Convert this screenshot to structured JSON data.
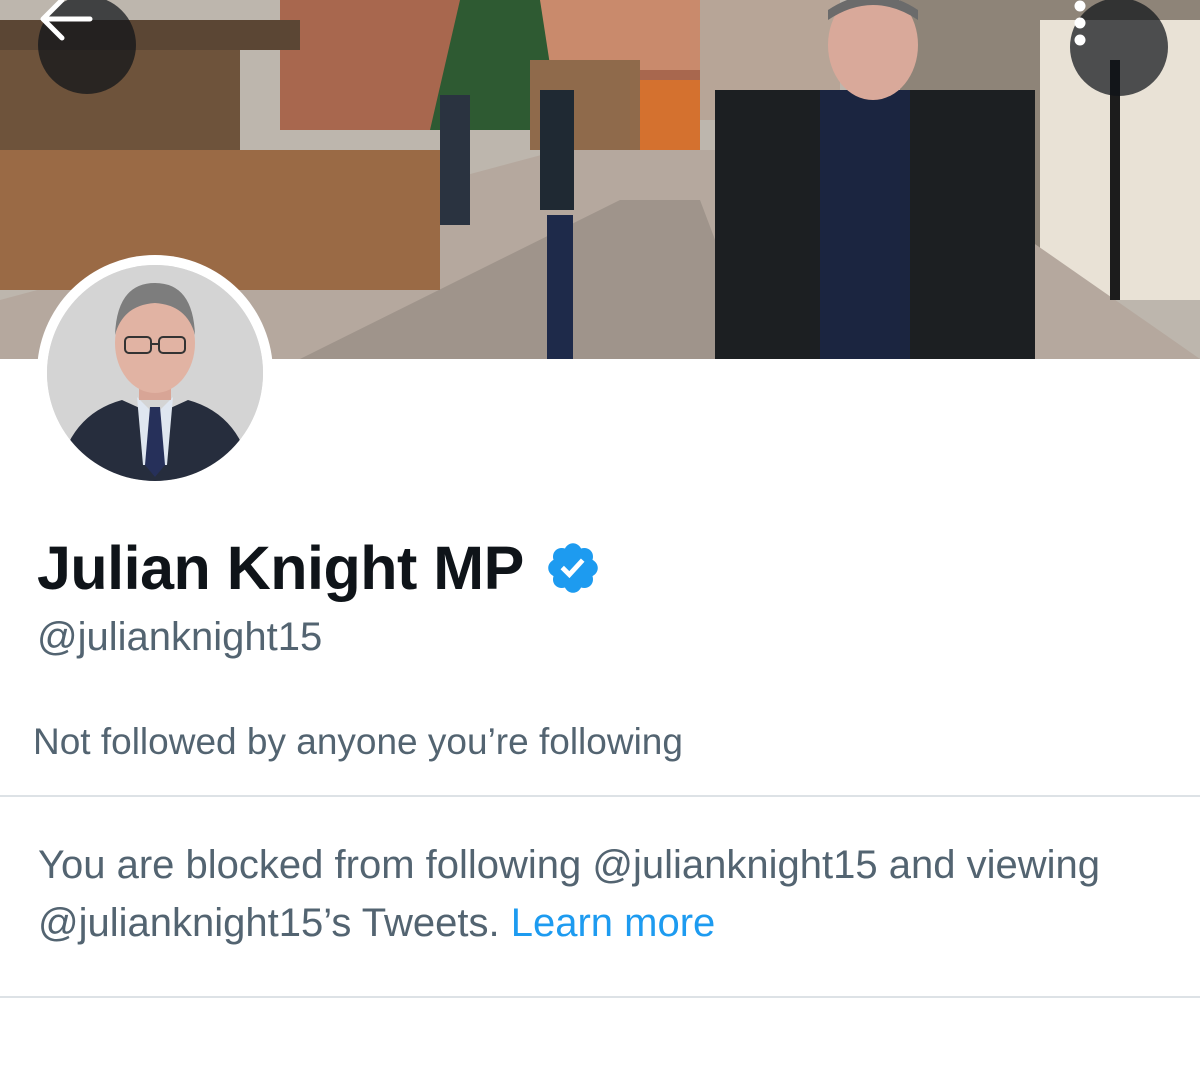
{
  "header": {
    "back_icon": "arrow-left-icon",
    "more_icon": "more-vertical-icon"
  },
  "profile": {
    "display_name": "Julian Knight MP",
    "verified": true,
    "verified_icon": "verified-badge-icon",
    "handle": "@julianknight15",
    "followers_you_know": "Not followed by anyone you’re following"
  },
  "blocked_notice": {
    "text": "You are blocked from following @julianknight15 and viewing @julianknight15’s Tweets.",
    "link_label": "Learn more"
  },
  "colors": {
    "accent": "#1d9bf0",
    "secondary_text": "#536471",
    "primary_text": "#0f1419"
  }
}
